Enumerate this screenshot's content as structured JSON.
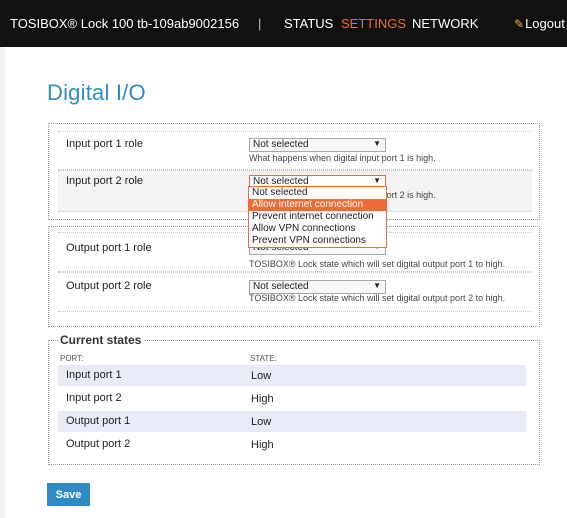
{
  "header": {
    "brand": "TOSIBOX® Lock 100 tb-109ab9002156",
    "separator": "|",
    "nav": [
      {
        "label": "STATUS",
        "active": false
      },
      {
        "label": "SETTINGS",
        "active": true
      },
      {
        "label": "NETWORK",
        "active": false
      }
    ],
    "logout_label": "Logout",
    "accent_color": "#ee6a36"
  },
  "page_title": "Digital I/O",
  "inputs": {
    "rows": [
      {
        "label": "Input port 1 role",
        "selected": "Not selected",
        "help": "What happens when digital input port 1 is high."
      },
      {
        "label": "Input port 2 role",
        "selected": "Not selected",
        "help": "What happens when digital input port 2 is high."
      }
    ],
    "dropdown_options": [
      "Not selected",
      "Allow internet connection",
      "Prevent internet connection",
      "Allow VPN connections",
      "Prevent VPN connections"
    ],
    "dropdown_highlighted": "Allow internet connection"
  },
  "outputs": {
    "rows": [
      {
        "label": "Output port 1 role",
        "selected": "Not selected",
        "help": "TOSIBOX® Lock state which will set digital output port 1 to high."
      },
      {
        "label": "Output port 2 role",
        "selected": "Not selected",
        "help": "TOSIBOX® Lock state which will set digital output port 2 to high."
      }
    ]
  },
  "current_states": {
    "title": "Current states",
    "col_port": "PORT:",
    "col_state": "STATE:",
    "rows": [
      {
        "port": "Input port 1",
        "state": "Low"
      },
      {
        "port": "Input port 2",
        "state": "High"
      },
      {
        "port": "Output port 1",
        "state": "Low"
      },
      {
        "port": "Output port 2",
        "state": "High"
      }
    ]
  },
  "save_label": "Save",
  "primary_color": "#2f8cc3"
}
